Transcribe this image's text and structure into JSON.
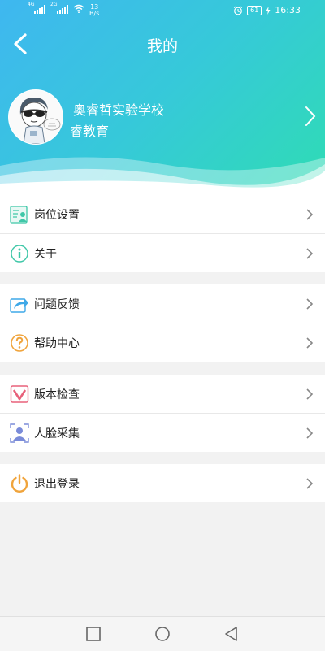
{
  "status_bar": {
    "network_1": "4G",
    "network_2": "2G",
    "speed_value": "13",
    "speed_unit": "B/s",
    "battery": "61",
    "time": "16:33"
  },
  "header": {
    "title": "我的",
    "school": "奥睿哲实验学校",
    "org": "睿教育"
  },
  "sections": [
    {
      "items": [
        {
          "label": "岗位设置",
          "icon": "job-settings-icon"
        },
        {
          "label": "关于",
          "icon": "info-icon"
        }
      ]
    },
    {
      "items": [
        {
          "label": "问题反馈",
          "icon": "share-arrow-icon"
        },
        {
          "label": "帮助中心",
          "icon": "question-icon"
        }
      ]
    },
    {
      "items": [
        {
          "label": "版本检查",
          "icon": "version-check-icon"
        },
        {
          "label": "人脸采集",
          "icon": "face-capture-icon"
        }
      ]
    },
    {
      "items": [
        {
          "label": "退出登录",
          "icon": "power-icon"
        }
      ]
    }
  ],
  "colors": {
    "gradient_start": "#3fb7f0",
    "gradient_end": "#2fdcb4",
    "page_background": "#f2f2f2"
  }
}
